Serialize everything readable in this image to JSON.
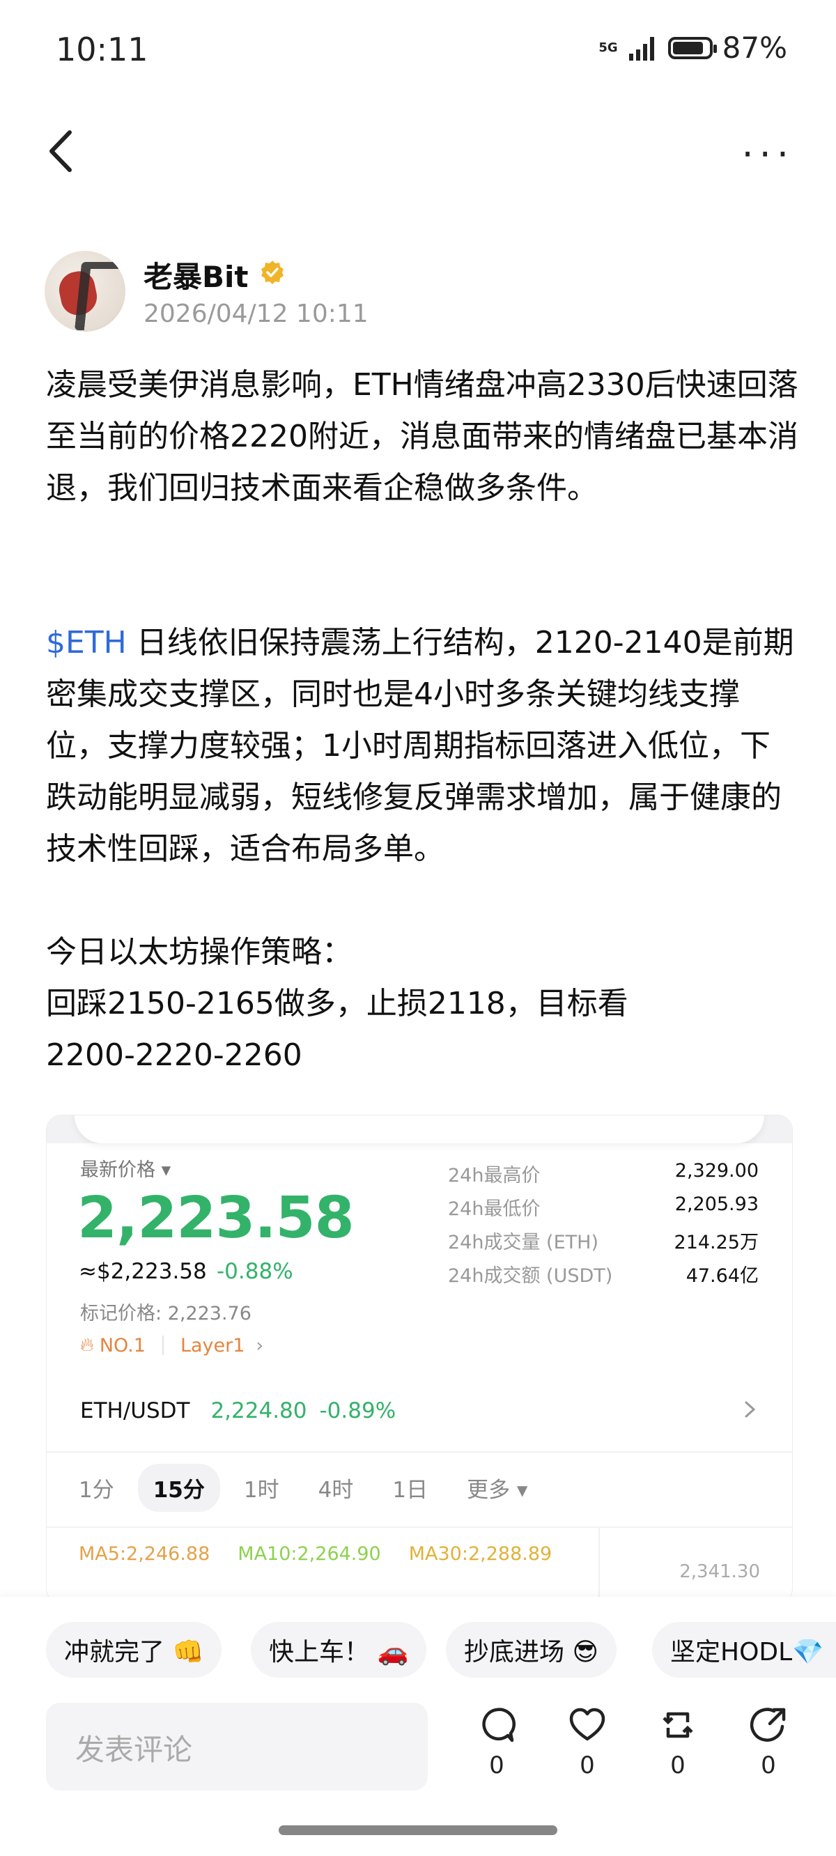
{
  "status": {
    "time": "10:11",
    "network": "5G",
    "battery": "87%",
    "battery_level": 0.87
  },
  "author": {
    "name": "老暴Bit",
    "time": "2026/04/12 10:11"
  },
  "post": {
    "p1": "凌晨受美伊消息影响，ETH情绪盘冲高2330后快速回落至当前的价格2220附近，消息面带来的情绪盘已基本消退，我们回归技术面来看企稳做多条件。",
    "tag": "$ETH",
    "p2": " 日线依旧保持震荡上行结构，2120-2140是前期密集成交支撑区，同时也是4小时多条关键均线支撑位，支撑力度较强；1小时周期指标回落进入低位，下跌动能明显减弱，短线修复反弹需求增加，属于健康的技术性回踩，适合布局多单。",
    "p3": "今日以太坊操作策略：\n回踩2150-2165做多，止损2118，目标看\n2200-2220-2260"
  },
  "card": {
    "latest_label": "最新价格 ▾",
    "price": "2,223.58",
    "usd_price": "≈$2,223.58",
    "change": "-0.88%",
    "mark_price": "标记价格: 2,223.76",
    "rank": "NO.1",
    "category": "Layer1",
    "stats": [
      {
        "label": "24h最高价",
        "value": "2,329.00"
      },
      {
        "label": "24h最低价",
        "value": "2,205.93"
      },
      {
        "label": "24h成交量 (ETH)",
        "value": "214.25万"
      },
      {
        "label": "24h成交额 (USDT)",
        "value": "47.64亿"
      }
    ],
    "pair": "ETH/USDT",
    "pair_price": "2,224.80",
    "pair_change": "-0.89%",
    "timeframes": [
      "1分",
      "15分",
      "1时",
      "4时",
      "1日",
      "更多 ▾"
    ],
    "ma5": "MA5:2,246.88",
    "ma10": "MA10:2,264.90",
    "ma30": "MA30:2,288.89",
    "axis_top": "2,341.30"
  },
  "quick_replies": [
    "冲就完了 👊",
    "快上车！ 🚗",
    "抄底进场 😎",
    "坚定HODL💎"
  ],
  "comment": {
    "placeholder": "发表评论"
  },
  "actions": [
    {
      "name": "comment",
      "count": "0"
    },
    {
      "name": "like",
      "count": "0"
    },
    {
      "name": "repost",
      "count": "0"
    },
    {
      "name": "share",
      "count": "0"
    }
  ]
}
